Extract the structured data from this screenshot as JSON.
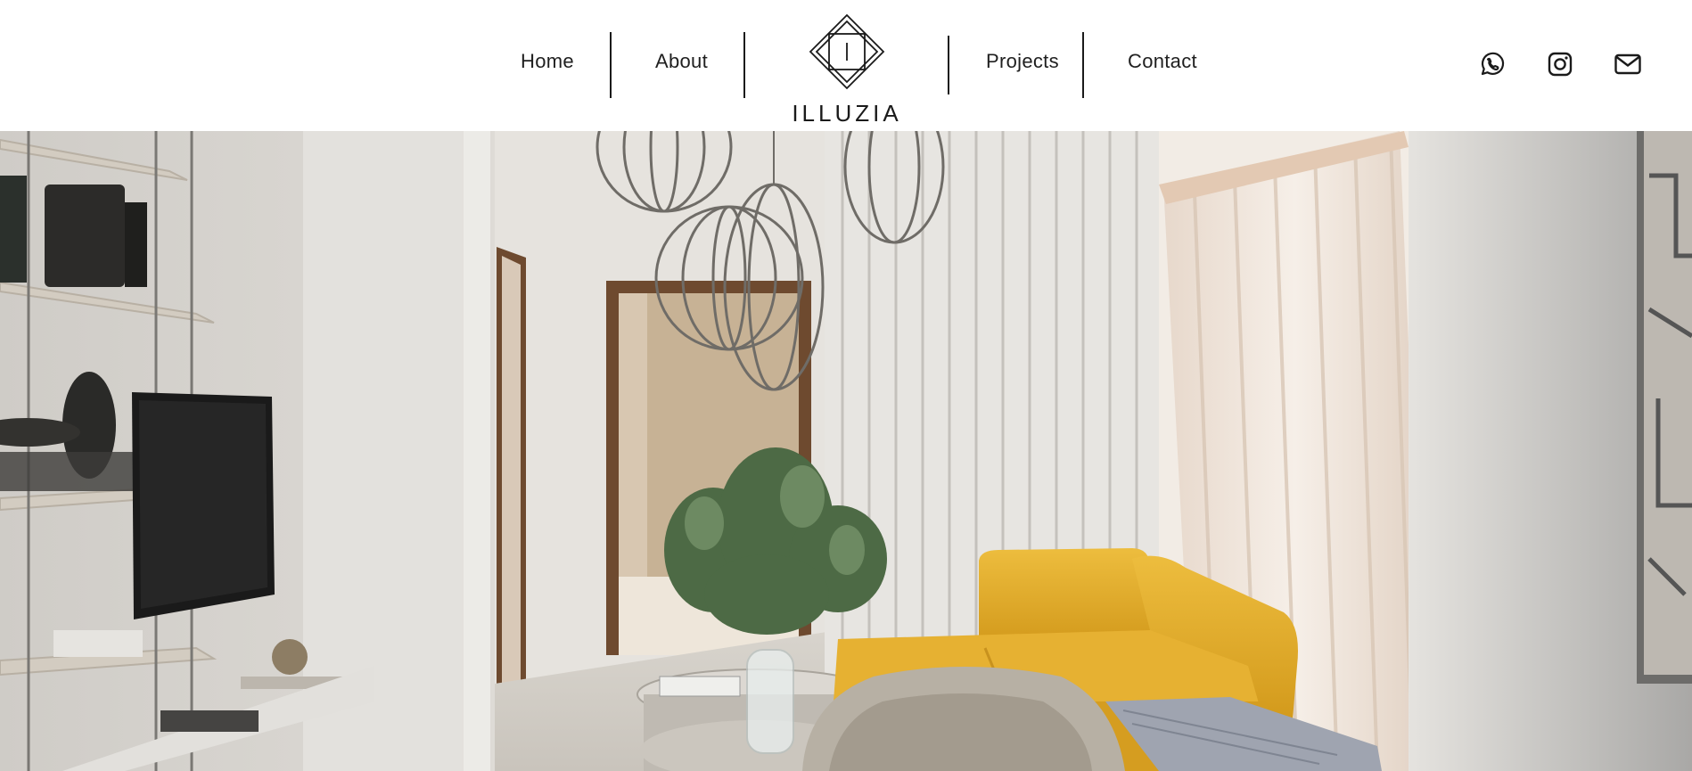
{
  "nav": {
    "home": "Home",
    "about": "About",
    "projects": "Projects",
    "contact": "Contact"
  },
  "brand": {
    "name": "ILLUZIA",
    "monogram": "I"
  },
  "social": {
    "icons": [
      "whatsapp-icon",
      "instagram-icon",
      "mail-icon"
    ]
  },
  "colors": {
    "header_bg": "#ffffff",
    "text": "#1f1f1f",
    "sofa": "#e6b132",
    "wall": "#dcdad6",
    "wood_frame": "#6e4a2f"
  }
}
